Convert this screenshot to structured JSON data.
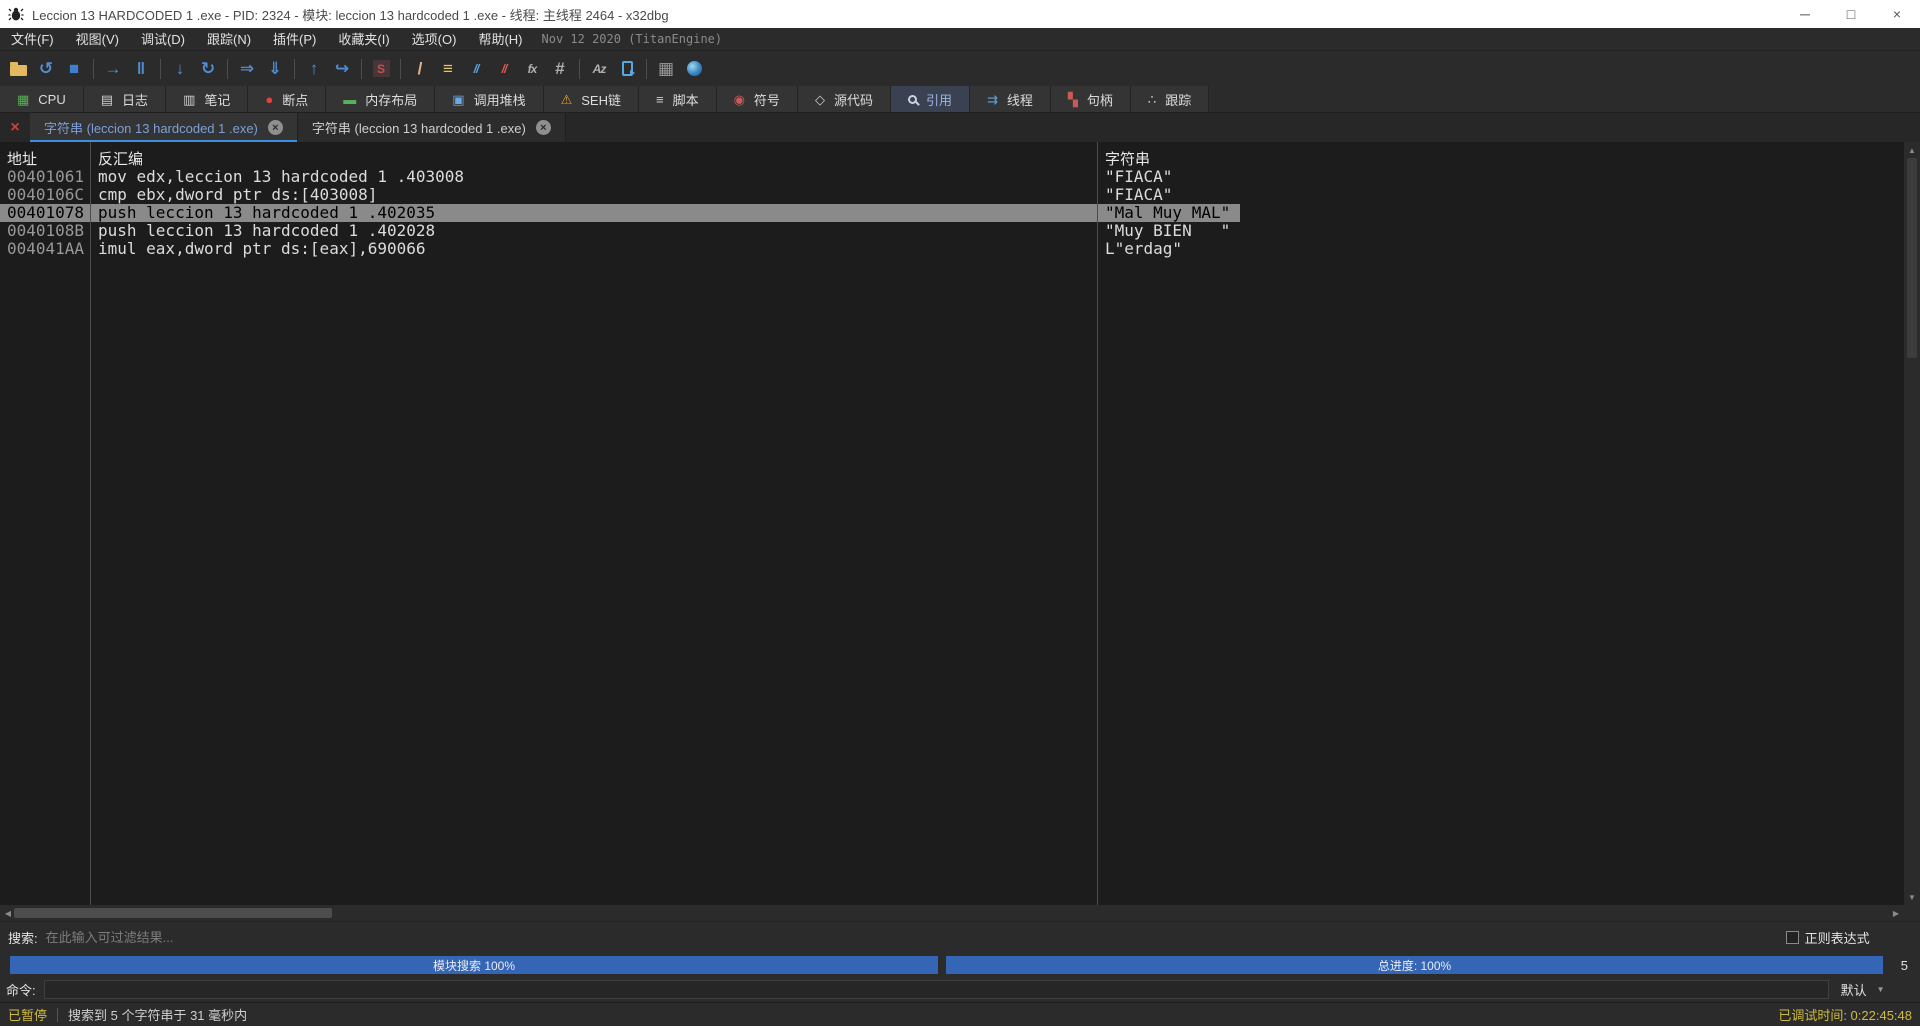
{
  "window": {
    "title": "Leccion 13 HARDCODED 1 .exe - PID: 2324 - 模块: leccion 13 hardcoded 1 .exe - 线程: 主线程 2464 - x32dbg"
  },
  "icons": {
    "minimize": "─",
    "maximize": "□",
    "close": "×",
    "close_tab": "×",
    "close_all": "×",
    "up": "▲",
    "down": "▼",
    "left": "◀",
    "right": "▶",
    "caret_down": "▼"
  },
  "menu": {
    "items": [
      {
        "id": "file",
        "label": "文件(F)"
      },
      {
        "id": "view",
        "label": "视图(V)"
      },
      {
        "id": "debug",
        "label": "调试(D)"
      },
      {
        "id": "trace",
        "label": "跟踪(N)"
      },
      {
        "id": "plugins",
        "label": "插件(P)"
      },
      {
        "id": "favourites",
        "label": "收藏夹(I)"
      },
      {
        "id": "options",
        "label": "选项(O)"
      },
      {
        "id": "help",
        "label": "帮助(H)"
      }
    ],
    "build_info": "Nov 12 2020 (TitanEngine)"
  },
  "toolbar": {
    "accent": "#4f8cd5",
    "groups": [
      [
        {
          "id": "open-file",
          "shape": "folder"
        },
        {
          "id": "restart",
          "glyph": "↺",
          "color": "#4f8cd5"
        },
        {
          "id": "stop",
          "glyph": "■",
          "color": "#3f7fd0"
        }
      ],
      [
        {
          "id": "run",
          "glyph": "→",
          "color": "#4f8cd5"
        },
        {
          "id": "pause",
          "glyph": "‖",
          "color": "#4f8cd5"
        }
      ],
      [
        {
          "id": "step-into",
          "glyph": "↓",
          "color": "#4f8cd5"
        },
        {
          "id": "step-over",
          "glyph": "↻",
          "color": "#4f8cd5"
        }
      ],
      [
        {
          "id": "run-trace",
          "glyph": "⇒",
          "color": "#4f8cd5"
        },
        {
          "id": "step-into-trace",
          "glyph": "⇓",
          "color": "#4f8cd5"
        }
      ],
      [
        {
          "id": "execute-till-return",
          "glyph": "↑",
          "color": "#4f8cd5"
        },
        {
          "id": "run-to-user-code",
          "glyph": "↪",
          "color": "#4f8cd5"
        }
      ],
      [
        {
          "id": "settings",
          "glyph": "S",
          "shape": "sbox"
        }
      ],
      [
        {
          "id": "patches",
          "glyph": "/",
          "color": "#e9b189"
        },
        {
          "id": "comments",
          "glyph": "≡",
          "color": "#e6c85a"
        },
        {
          "id": "edit-columns",
          "glyph": "//",
          "color": "#5aa7e0",
          "small": true
        },
        {
          "id": "highlight",
          "glyph": "//",
          "color": "#e05a5a",
          "small": true
        },
        {
          "id": "functions",
          "glyph": "fx",
          "color": "#b0b0b0",
          "small": true
        },
        {
          "id": "labels",
          "glyph": "#",
          "color": "#b0b0b0"
        }
      ],
      [
        {
          "id": "strings",
          "glyph": "Az",
          "color": "#b0b0b0",
          "small": true
        },
        {
          "id": "modules",
          "shape": "device"
        }
      ],
      [
        {
          "id": "calculator",
          "glyph": "▦",
          "color": "#9a9a9a"
        },
        {
          "id": "help-globe",
          "shape": "globe"
        }
      ]
    ]
  },
  "tabs": {
    "items": [
      {
        "id": "cpu",
        "label": "CPU",
        "glyph": "▦",
        "color": "#58b058"
      },
      {
        "id": "log",
        "label": "日志",
        "glyph": "▤",
        "color": "#cfcfcf"
      },
      {
        "id": "notes",
        "label": "笔记",
        "glyph": "▥",
        "color": "#cfcfcf"
      },
      {
        "id": "breakpoints",
        "label": "断点",
        "glyph": "●",
        "color": "#e04343"
      },
      {
        "id": "memory-map",
        "label": "内存布局",
        "glyph": "▬",
        "color": "#58b058"
      },
      {
        "id": "call-stack",
        "label": "调用堆栈",
        "glyph": "▣",
        "color": "#6fa8e0"
      },
      {
        "id": "seh-chain",
        "label": "SEH链",
        "glyph": "⚠",
        "color": "#e0a030"
      },
      {
        "id": "script",
        "label": "脚本",
        "glyph": "≡",
        "color": "#cfcfcf"
      },
      {
        "id": "symbols",
        "label": "符号",
        "glyph": "◉",
        "color": "#d05858"
      },
      {
        "id": "source-code",
        "label": "源代码",
        "glyph": "◇",
        "color": "#cfcfcf"
      },
      {
        "id": "references",
        "label": "引用",
        "magnifier": true,
        "selected": true
      },
      {
        "id": "threads",
        "label": "线程",
        "glyph": "⇉",
        "color": "#5aa7e0"
      },
      {
        "id": "handles",
        "label": "句柄",
        "glyph": "▚",
        "color": "#c85a5a"
      },
      {
        "id": "trace",
        "label": "跟踪",
        "glyph": "∴",
        "color": "#cfcfcf"
      }
    ]
  },
  "subtabs": {
    "items": [
      {
        "label": "字符串 (leccion 13 hardcoded 1 .exe)",
        "active": true
      },
      {
        "label": "字符串 (leccion 13 hardcoded 1 .exe)",
        "active": false
      }
    ]
  },
  "table": {
    "columns": [
      "地址",
      "反汇编",
      "字符串"
    ],
    "rows": [
      {
        "address": "00401061",
        "disasm": "mov edx,leccion 13 hardcoded 1 .403008",
        "string": "\"FIACA\"",
        "selected": false
      },
      {
        "address": "0040106C",
        "disasm": "cmp ebx,dword ptr ds:[403008]",
        "string": "\"FIACA\"",
        "selected": false
      },
      {
        "address": "00401078",
        "disasm": "push leccion 13 hardcoded 1 .402035",
        "string": "\"Mal Muy MAL\"",
        "selected": true
      },
      {
        "address": "0040108B",
        "disasm": "push leccion 13 hardcoded 1 .402028",
        "string": "\"Muy BIEN   \"",
        "selected": false
      },
      {
        "address": "004041AA",
        "disasm": "imul eax,dword ptr ds:[eax],690066",
        "string": "L\"erdag\"",
        "selected": false
      }
    ]
  },
  "search": {
    "label": "搜索:",
    "placeholder": "在此输入可过滤结果...",
    "regex_label": "正则表达式",
    "regex_checked": false
  },
  "progress": {
    "module_label": "模块搜索 100%",
    "total_label": "总进度: 100%",
    "count": "5",
    "bar_color": "#3565b5"
  },
  "command": {
    "label": "命令:",
    "value": "",
    "profile": "默认"
  },
  "statusbar": {
    "state": "已暂停",
    "message": "搜索到 5 个字符串于 31 毫秒内",
    "debug_time": "已调试时间: 0:22:45:48"
  }
}
